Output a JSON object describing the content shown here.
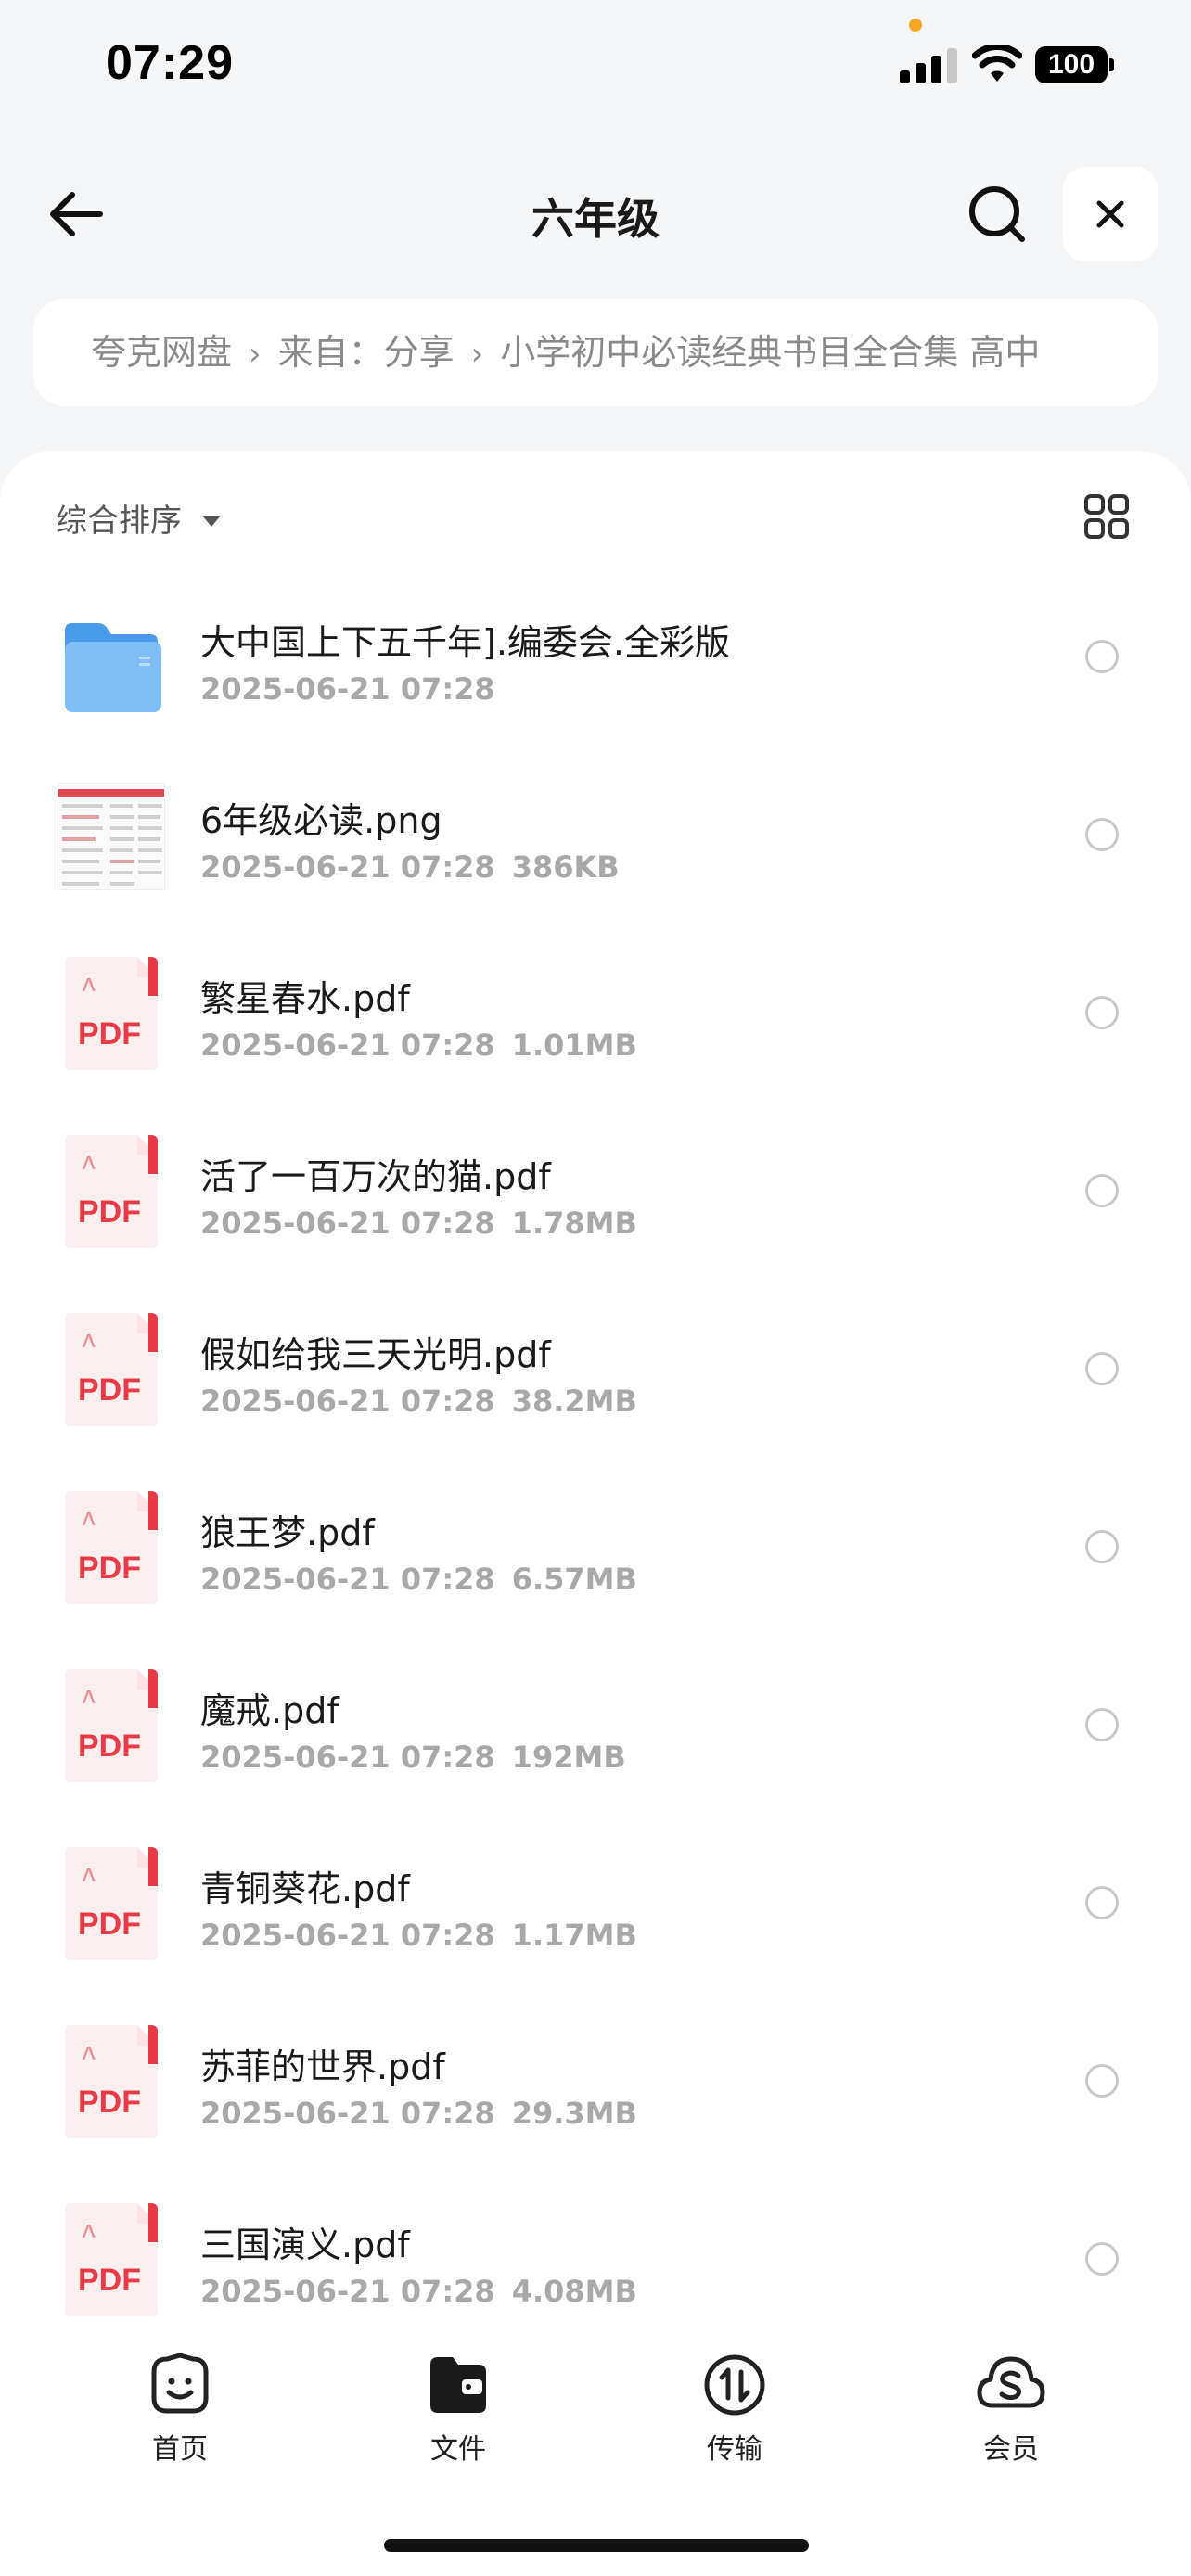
{
  "status_bar": {
    "time": "07:29",
    "battery": "100"
  },
  "nav": {
    "title": "六年级",
    "back_icon": "arrow-left-icon",
    "search_icon": "search-icon",
    "close_icon": "close-icon"
  },
  "breadcrumb": {
    "items": [
      "夸克网盘",
      "来自：分享",
      "小学初中必读经典书目全合集 高中"
    ]
  },
  "toolbar": {
    "sort_label": "综合排序",
    "view_icon": "grid-view-icon"
  },
  "files": [
    {
      "name": "大中国上下五千年].编委会.全彩版",
      "date": "2025-06-21 07:28",
      "size": "",
      "type": "folder"
    },
    {
      "name": "6年级必读.png",
      "date": "2025-06-21 07:28",
      "size": "386KB",
      "type": "image"
    },
    {
      "name": "繁星春水.pdf",
      "date": "2025-06-21 07:28",
      "size": "1.01MB",
      "type": "pdf"
    },
    {
      "name": "活了一百万次的猫.pdf",
      "date": "2025-06-21 07:28",
      "size": "1.78MB",
      "type": "pdf"
    },
    {
      "name": "假如给我三天光明.pdf",
      "date": "2025-06-21 07:28",
      "size": "38.2MB",
      "type": "pdf"
    },
    {
      "name": "狼王梦.pdf",
      "date": "2025-06-21 07:28",
      "size": "6.57MB",
      "type": "pdf"
    },
    {
      "name": "魔戒.pdf",
      "date": "2025-06-21 07:28",
      "size": "192MB",
      "type": "pdf"
    },
    {
      "name": "青铜葵花.pdf",
      "date": "2025-06-21 07:28",
      "size": "1.17MB",
      "type": "pdf"
    },
    {
      "name": "苏菲的世界.pdf",
      "date": "2025-06-21 07:28",
      "size": "29.3MB",
      "type": "pdf"
    },
    {
      "name": "三国演义.pdf",
      "date": "2025-06-21 07:28",
      "size": "4.08MB",
      "type": "pdf"
    }
  ],
  "pdf_label": "PDF",
  "tabs": [
    {
      "label": "首页",
      "icon": "home-face-icon"
    },
    {
      "label": "文件",
      "icon": "folder-wallet-icon"
    },
    {
      "label": "传输",
      "icon": "transfer-icon"
    },
    {
      "label": "会员",
      "icon": "vip-cloud-icon"
    }
  ],
  "colors": {
    "pdf_red": "#e83b45",
    "folder_blue": "#5aa8f0",
    "status_dot": "#f5a623"
  }
}
